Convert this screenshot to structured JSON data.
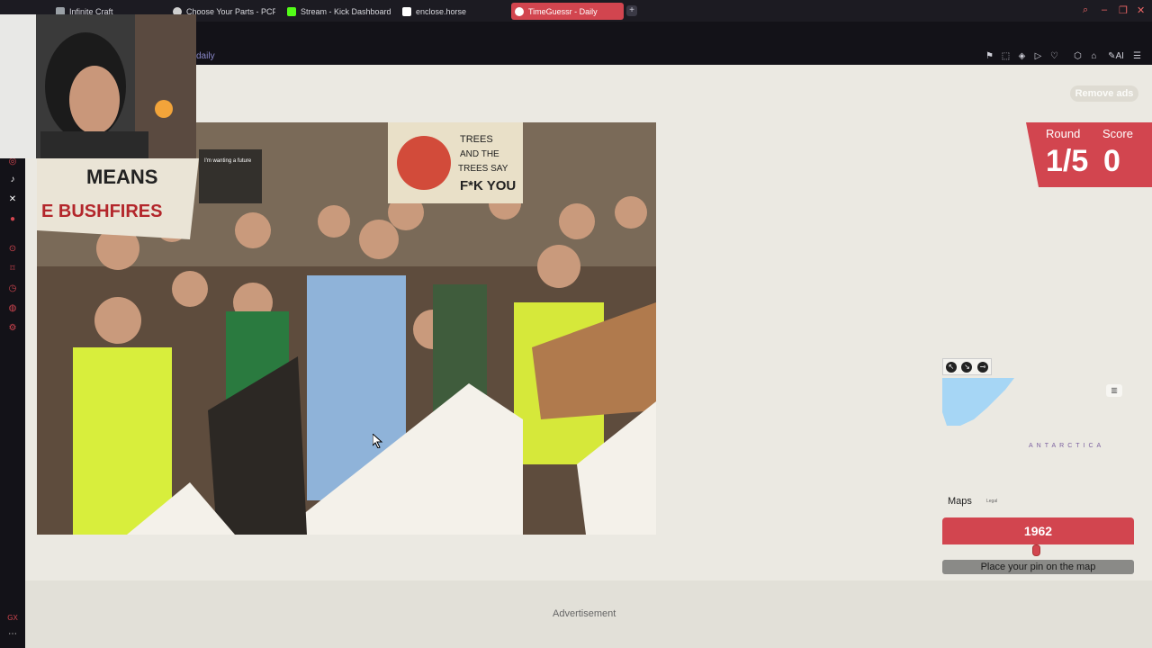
{
  "browser": {
    "tabs": [
      {
        "label": "Infinite Craft",
        "color": "#9aa0a6"
      },
      {
        "label": "Choose Your Parts - PCPa",
        "color": "#cfcfcf"
      },
      {
        "label": "Stream - Kick Dashboard",
        "color": "#53fc18"
      },
      {
        "label": "enclose.horse",
        "color": "#ffffff"
      },
      {
        "label": "TimeGuessr - Daily",
        "color": "#d2454f",
        "active": true
      }
    ],
    "new_tab": "+",
    "url": "daily"
  },
  "page": {
    "remove_ads": "Remove ads",
    "round_label": "Round",
    "round_value": "1/5",
    "score_label": "Score",
    "score_value": "0",
    "map": {
      "region_label": "ANTARCTICA",
      "maps_brand": "Maps",
      "legal": "Legal"
    },
    "year": "1962",
    "slider_fraction": 0.49,
    "place_pin": "Place your pin on the map",
    "advertisement": "Advertisement"
  },
  "photo": {
    "signs": [
      "MEANS",
      "E BUSHFIRES",
      "TREES",
      "AND THE",
      "TREES SAY",
      "F*K YOU",
      "I'm wanting a future"
    ]
  },
  "colors": {
    "accent": "#d2454f",
    "page_bg": "#ebe9e2"
  }
}
